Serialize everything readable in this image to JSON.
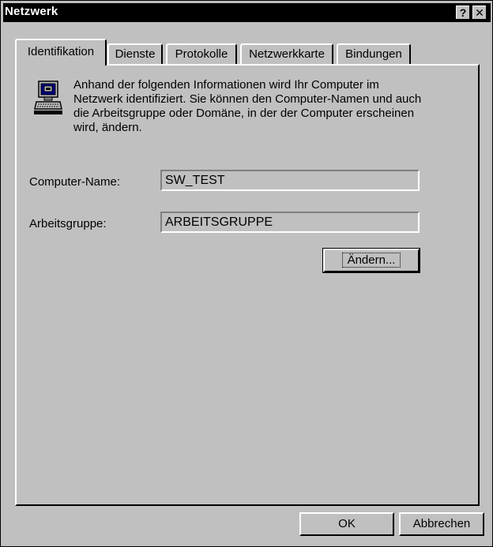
{
  "window": {
    "title": "Netzwerk",
    "help_label": "?",
    "close_label": "✕"
  },
  "tabs": [
    {
      "label": "Identifikation",
      "active": true
    },
    {
      "label": "Dienste",
      "active": false
    },
    {
      "label": "Protokolle",
      "active": false
    },
    {
      "label": "Netzwerkkarte",
      "active": false
    },
    {
      "label": "Bindungen",
      "active": false
    }
  ],
  "identification": {
    "info_icon": "network-computer-icon",
    "info_text": "Anhand der folgenden Informationen wird Ihr Computer im Netzwerk identifiziert. Sie können den Computer-Namen und auch die Arbeitsgruppe oder Domäne, in der der Computer erscheinen wird, ändern.",
    "computer_name_label": "Computer-Name:",
    "computer_name_value": "SW_TEST",
    "workgroup_label": "Arbeitsgruppe:",
    "workgroup_value": "ARBEITSGRUPPE",
    "change_button_label": "Ändern..."
  },
  "footer": {
    "ok_label": "OK",
    "cancel_label": "Abbrechen"
  }
}
